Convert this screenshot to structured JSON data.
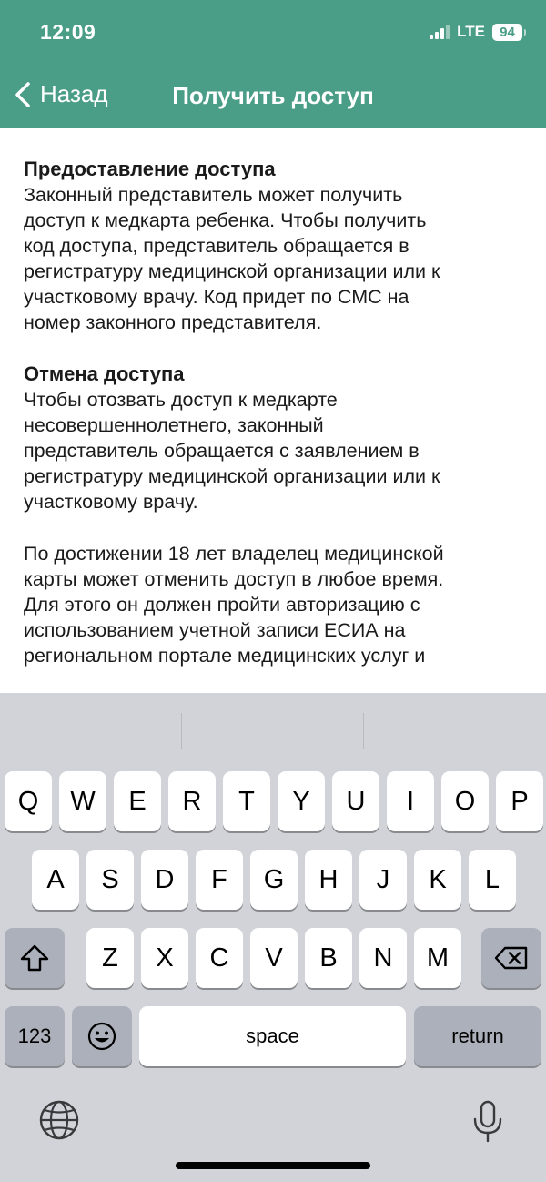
{
  "status_bar": {
    "time": "12:09",
    "network": "LTE",
    "battery": "94"
  },
  "nav": {
    "back_label": "Назад",
    "title": "Получить доступ"
  },
  "content": {
    "section1_title": "Предоставление доступа",
    "section1_lines": [
      "Законный представитель может получить",
      "доступ к медкарта ребенка. Чтобы получить",
      "код доступа, представитель обращается в",
      "регистратуру медицинской организации или к",
      "участковому врачу. Код придет по СМС на",
      "номер законного представителя."
    ],
    "section2_title": "Отмена доступа",
    "section2_lines": [
      "Чтобы отозвать доступ к медкарте",
      "несовершеннолетнего, законный",
      "представитель обращается с заявлением в",
      "регистратуру медицинской организации или к",
      "участковому врачу."
    ],
    "section3_lines": [
      "По достижении 18 лет владелец медицинской",
      "карты может отменить доступ в любое время.",
      "Для этого он должен пройти авторизацию с",
      "использованием учетной записи ЕСИА на",
      "региональном портале медицинских услуг и"
    ]
  },
  "keyboard": {
    "row1": [
      "Q",
      "W",
      "E",
      "R",
      "T",
      "Y",
      "U",
      "I",
      "O",
      "P"
    ],
    "row2": [
      "A",
      "S",
      "D",
      "F",
      "G",
      "H",
      "J",
      "K",
      "L"
    ],
    "row3": [
      "Z",
      "X",
      "C",
      "V",
      "B",
      "N",
      "M"
    ],
    "numbers_label": "123",
    "space_label": "space",
    "return_label": "return"
  },
  "colors": {
    "header": "#4a9d86",
    "keyboard_bg": "#d1d3d9",
    "key": "#ffffff",
    "key_dark": "#abb0ba"
  }
}
